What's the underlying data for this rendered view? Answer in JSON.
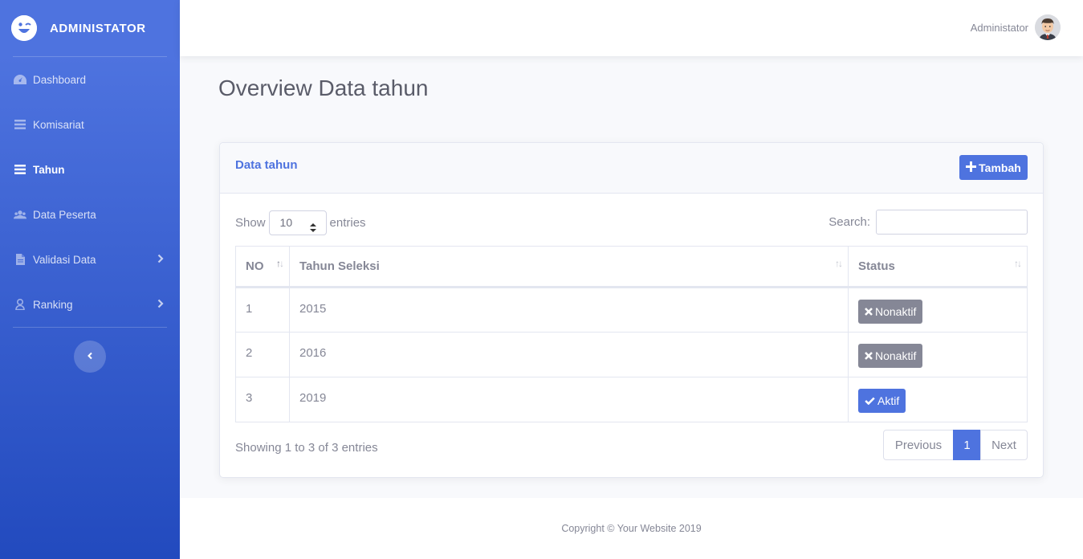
{
  "sidebar": {
    "brand": "ADMINISTATOR",
    "items": [
      {
        "label": "Dashboard",
        "icon": "tachometer-icon"
      },
      {
        "label": "Komisariat",
        "icon": "list-icon"
      },
      {
        "label": "Tahun",
        "icon": "list-icon",
        "active": true
      },
      {
        "label": "Data Peserta",
        "icon": "users-icon"
      },
      {
        "label": "Validasi Data",
        "icon": "file-icon"
      },
      {
        "label": "Ranking",
        "icon": "user-icon"
      }
    ]
  },
  "topbar": {
    "user_name": "Administator"
  },
  "page": {
    "title": "Overview Data tahun"
  },
  "card": {
    "title": "Data tahun",
    "add_button": "Tambah",
    "length_prefix": "Show",
    "length_value": "10",
    "length_suffix": "entries",
    "search_label": "Search:",
    "search_value": ""
  },
  "table": {
    "headers": [
      "NO",
      "Tahun Seleksi",
      "Status"
    ],
    "rows": [
      {
        "no": "1",
        "year": "2015",
        "status": "Nonaktif"
      },
      {
        "no": "2",
        "year": "2016",
        "status": "Nonaktif"
      },
      {
        "no": "3",
        "year": "2019",
        "status": "Aktif"
      }
    ],
    "info": "Showing 1 to 3 of 3 entries"
  },
  "pagination": {
    "previous": "Previous",
    "page": "1",
    "next": "Next"
  },
  "footer": {
    "copyright": "Copyright © Your Website 2019"
  },
  "colors": {
    "primary": "#4e73df",
    "secondary": "#858796"
  }
}
